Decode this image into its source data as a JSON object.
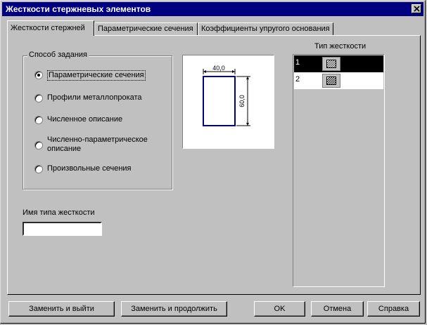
{
  "window": {
    "title": "Жесткости стержневых элементов"
  },
  "tabs": [
    {
      "label": "Жесткости стержней",
      "active": true
    },
    {
      "label": "Параметрические сечения",
      "active": false
    },
    {
      "label": "Коэффициенты упругого основания",
      "active": false
    }
  ],
  "method_group": {
    "legend": "Способ задания",
    "options": [
      {
        "label": "Параметрические сечения",
        "checked": true
      },
      {
        "label": "Профили металлопроката",
        "checked": false
      },
      {
        "label": "Численное описание",
        "checked": false
      },
      {
        "label": "Численно-параметрическое описание",
        "label_line1": "Численно-параметрическое",
        "label_line2": "описание",
        "checked": false
      },
      {
        "label": "Произвольные сечения",
        "checked": false
      }
    ]
  },
  "preview": {
    "width_label": "40,0",
    "height_label": "60,0",
    "shape_color": "#000080"
  },
  "stiffness_name": {
    "label": "Имя типа жесткости",
    "value": ""
  },
  "stiffness_list": {
    "header": "Тип жесткости",
    "rows": [
      {
        "num": "1",
        "selected": true
      },
      {
        "num": "2",
        "selected": false
      }
    ]
  },
  "buttons": {
    "replace_exit": "Заменить и выйти",
    "replace_continue": "Заменить и продолжить",
    "ok": "OK",
    "cancel": "Отмена",
    "help": "Справка"
  }
}
